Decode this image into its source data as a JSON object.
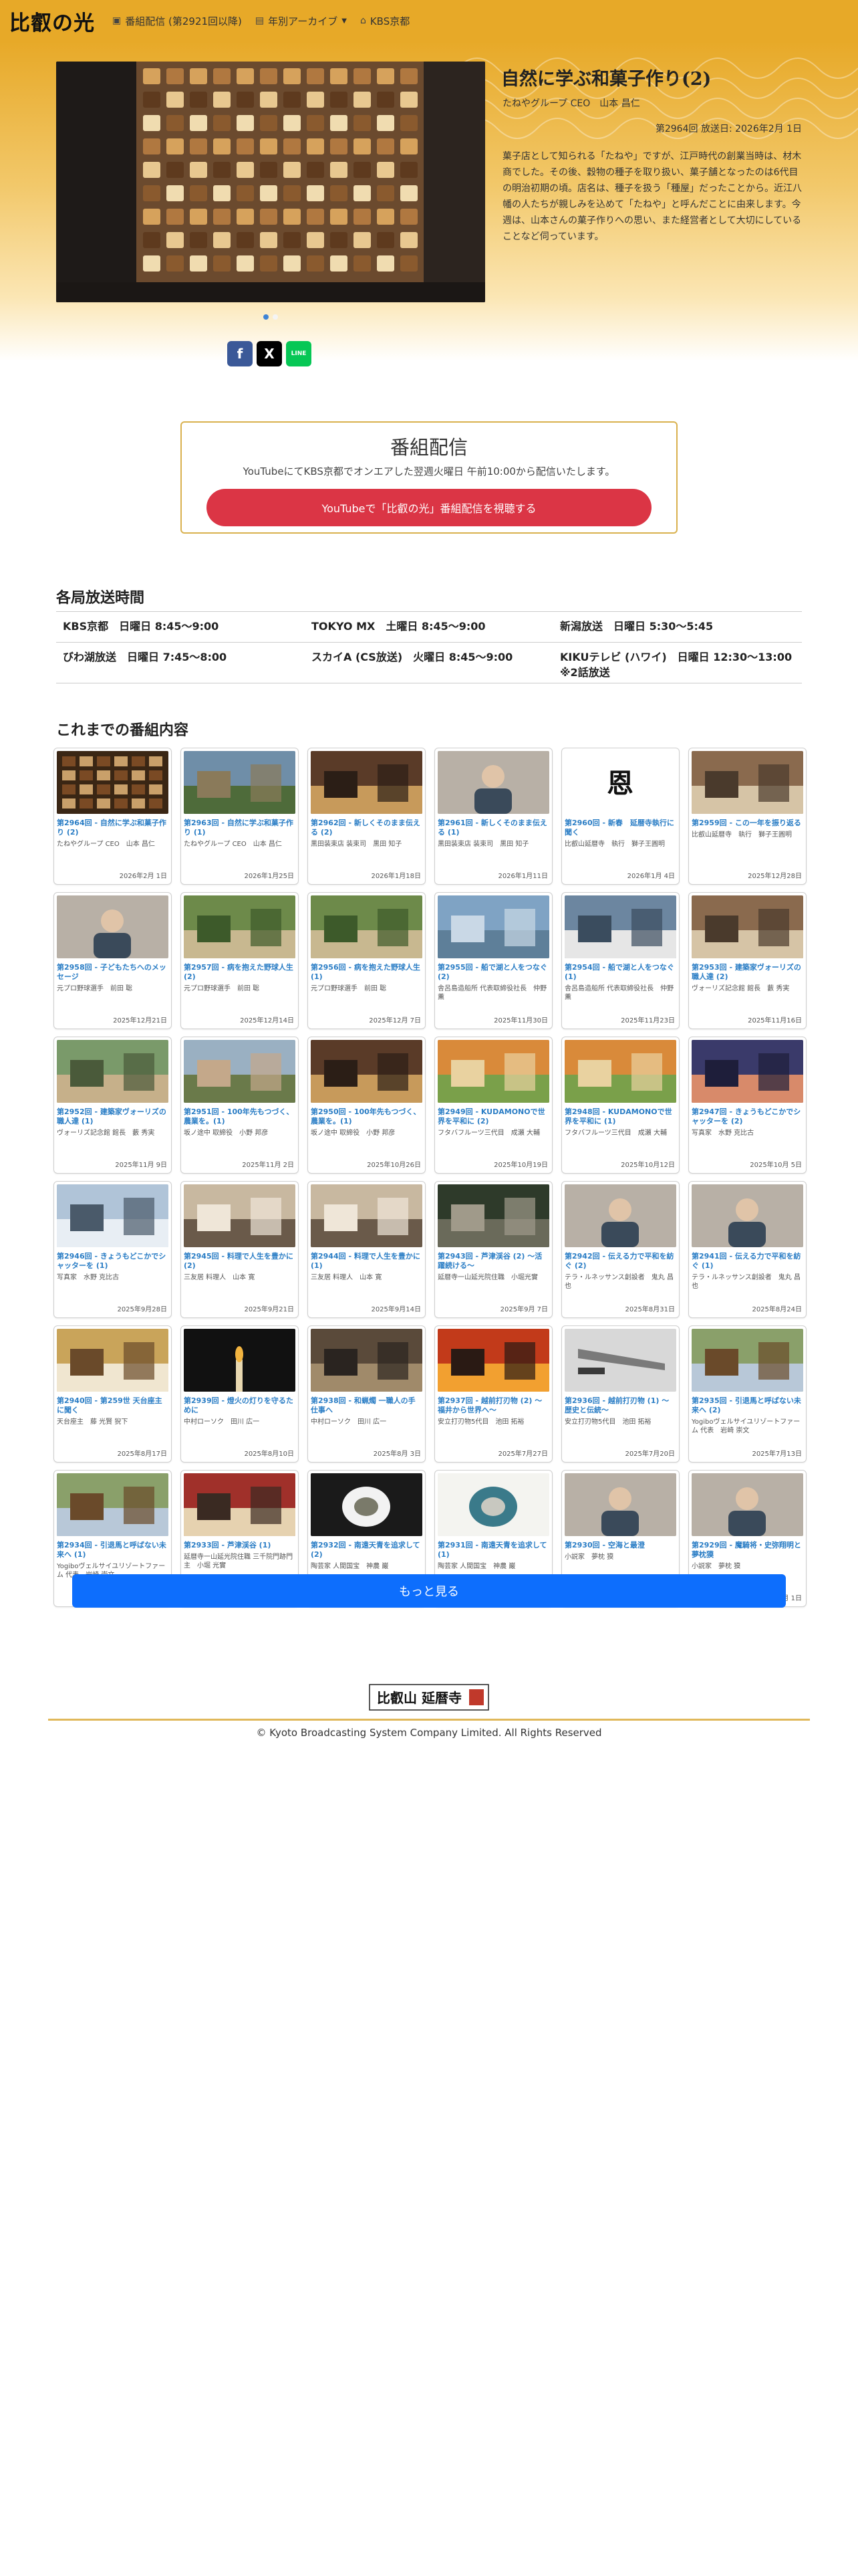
{
  "nav": {
    "brand": "比叡の光",
    "links": [
      {
        "label": "番組配信 (第2921回以降)",
        "icon": "tv-icon"
      },
      {
        "label": "年別アーカイブ",
        "icon": "calendar-icon"
      },
      {
        "label": "KBS京都",
        "icon": "home-icon"
      }
    ]
  },
  "featured": {
    "title": "自然に学ぶ和菓子作り(2)",
    "guest": "たねやグループ CEO　山本 昌仁",
    "date": "第2964回 放送日: 2026年2月 1日",
    "description": "菓子店として知られる「たねや」ですが、江戸時代の創業当時は、材木商でした。その後、穀物の種子を取り扱い、菓子舗となったのは6代目の明治初期の頃。店名は、種子を扱う「種屋」だったことから。近江八幡の人たちが親しみを込めて「たねや」と呼んだことに由来します。今週は、山本さんの菓子作りへの思い、また経営者として大切にしていることなど伺っています。"
  },
  "share": {
    "facebook": "f",
    "x": "X",
    "line": "LINE"
  },
  "broadcast": {
    "title": "番組配信",
    "text": "YouTubeにてKBS京都でオンエアした翌週火曜日 午前10:00から配信いたします。",
    "button": "YouTubeで「比叡の光」番組配信を視聴する"
  },
  "schedule": {
    "title": "各局放送時間",
    "rows": [
      [
        "KBS京都　日曜日 8:45〜9:00",
        "TOKYO MX　土曜日 8:45〜9:00",
        "新潟放送　日曜日 5:30〜5:45"
      ],
      [
        "びわ湖放送　日曜日 7:45〜8:00",
        "スカイA (CS放送)　火曜日 8:45〜9:00",
        "KIKUテレビ (ハワイ)　日曜日 12:30〜13:00\n※2話放送"
      ]
    ]
  },
  "episodes": {
    "title": "これまでの番組内容",
    "items": [
      {
        "title": "第2964回 - 自然に学ぶ和菓子作り (2)",
        "guest": "たねやグループ CEO　山本 昌仁",
        "date": "2026年2月 1日",
        "thumb": "sweets"
      },
      {
        "title": "第2963回 - 自然に学ぶ和菓子作り (1)",
        "guest": "たねやグループ CEO　山本 昌仁",
        "date": "2026年1月25日",
        "thumb": "landscape"
      },
      {
        "title": "第2962回 - 新しくそのまま伝える (2)",
        "guest": "黒田装束店 装束司　黒田 知子",
        "date": "2026年1月18日",
        "thumb": "interior"
      },
      {
        "title": "第2961回 - 新しくそのまま伝える (1)",
        "guest": "黒田装束店 装束司　黒田 知子",
        "date": "2026年1月11日",
        "thumb": "person"
      },
      {
        "title": "第2960回 - 新春　延暦寺執行に聞く",
        "guest": "比叡山延暦寺　執行　獅子王圓明",
        "date": "2026年1月 4日",
        "thumb": "calligraphy"
      },
      {
        "title": "第2959回 - この一年を振り返る",
        "guest": "比叡山延暦寺　執行　獅子王圓明",
        "date": "2025年12月28日",
        "thumb": "room"
      },
      {
        "title": "第2958回 - 子どもたちへのメッセージ",
        "guest": "元プロ野球選手　前田 聡",
        "date": "2025年12月21日",
        "thumb": "person"
      },
      {
        "title": "第2957回 - 病を抱えた野球人生 (2)",
        "guest": "元プロ野球選手　前田 聡",
        "date": "2025年12月14日",
        "thumb": "field"
      },
      {
        "title": "第2956回 - 病を抱えた野球人生 (1)",
        "guest": "元プロ野球選手　前田 聡",
        "date": "2025年12月 7日",
        "thumb": "field"
      },
      {
        "title": "第2955回 - 船で湖と人をつなぐ (2)",
        "guest": "舎呂島造船所 代表取締役社長　仲野 薫",
        "date": "2025年11月30日",
        "thumb": "lake"
      },
      {
        "title": "第2954回 - 船で湖と人をつなぐ (1)",
        "guest": "舎呂島造船所 代表取締役社長　仲野 薫",
        "date": "2025年11月23日",
        "thumb": "boat"
      },
      {
        "title": "第2953回 - 建築家ヴォーリズの職人達 (2)",
        "guest": "ヴォーリズ記念館 館長　藪 秀実",
        "date": "2025年11月16日",
        "thumb": "room"
      },
      {
        "title": "第2952回 - 建築家ヴォーリズの職人達 (1)",
        "guest": "ヴォーリズ記念館 館長　藪 秀実",
        "date": "2025年11月 9日",
        "thumb": "house"
      },
      {
        "title": "第2951回 - 100年先もつづく、農業を。(1)",
        "guest": "坂ノ途中 取締役　小野 邦彦",
        "date": "2025年11月 2日",
        "thumb": "crowd"
      },
      {
        "title": "第2950回 - 100年先もつづく、農業を。(1)",
        "guest": "坂ノ途中 取締役　小野 邦彦",
        "date": "2025年10月26日",
        "thumb": "interior"
      },
      {
        "title": "第2949回 - KUDAMONOで世界を平和に (2)",
        "guest": "フタバフルーツ三代目　成瀬 大輔",
        "date": "2025年10月19日",
        "thumb": "fruit"
      },
      {
        "title": "第2948回 - KUDAMONOで世界を平和に (1)",
        "guest": "フタバフルーツ三代目　成瀬 大輔",
        "date": "2025年10月12日",
        "thumb": "fruit"
      },
      {
        "title": "第2947回 - きょうもどこかでシャッターを (2)",
        "guest": "写真家　水野 克比古",
        "date": "2025年10月 5日",
        "thumb": "sunset"
      },
      {
        "title": "第2946回 - きょうもどこかでシャッターを (1)",
        "guest": "写真家　水野 克比古",
        "date": "2025年9月28日",
        "thumb": "bridge"
      },
      {
        "title": "第2945回 - 料理で人生を豊かに (2)",
        "guest": "三友居 料理人　山本 寛",
        "date": "2025年9月21日",
        "thumb": "kitchen"
      },
      {
        "title": "第2944回 - 料理で人生を豊かに (1)",
        "guest": "三友居 料理人　山本 寛",
        "date": "2025年9月14日",
        "thumb": "kitchen"
      },
      {
        "title": "第2943回 - 芦津渓谷 (2) 〜活躍続ける〜",
        "guest": "延暦寺一山延光院住職　小堀光實",
        "date": "2025年9月 7日",
        "thumb": "forest"
      },
      {
        "title": "第2942回 - 伝える力で平和を紡ぐ (2)",
        "guest": "テラ・ルネッサンス創設者　鬼丸 昌也",
        "date": "2025年8月31日",
        "thumb": "person"
      },
      {
        "title": "第2941回 - 伝える力で平和を紡ぐ (1)",
        "guest": "テラ・ルネッサンス創設者　鬼丸 昌也",
        "date": "2025年8月24日",
        "thumb": "person"
      },
      {
        "title": "第2940回 - 第259世 天台座主に聞く",
        "guest": "天台座主　藤 光賢 猊下",
        "date": "2025年8月17日",
        "thumb": "monk"
      },
      {
        "title": "第2939回 - 燈火の灯りを守るために",
        "guest": "中村ローソク　田川 広一",
        "date": "2025年8月10日",
        "thumb": "candle"
      },
      {
        "title": "第2938回 - 和蝋燭 一職人の手仕事へ",
        "guest": "中村ローソク　田川 広一",
        "date": "2025年8月 3日",
        "thumb": "workshop"
      },
      {
        "title": "第2937回 - 越前打刃物 (2) 〜福井から世界へ〜",
        "guest": "安立打刃物5代目　池田 拓裕",
        "date": "2025年7月27日",
        "thumb": "fire"
      },
      {
        "title": "第2936回 - 越前打刃物 (1) 〜歴史と伝統〜",
        "guest": "安立打刃物5代目　池田 拓裕",
        "date": "2025年7月20日",
        "thumb": "knife"
      },
      {
        "title": "第2935回 - 引退馬と呼ばない未来へ (2)",
        "guest": "Yogiboヴェルサイユリゾートファーム 代表　岩崎 崇文",
        "date": "2025年7月13日",
        "thumb": "horse"
      },
      {
        "title": "第2934回 - 引退馬と呼ばない未来へ (1)",
        "guest": "Yogiboヴェルサイユリゾートファーム 代表　岩崎 崇文",
        "date": "2025年7月 6日",
        "thumb": "horse"
      },
      {
        "title": "第2933回 - 芦津渓谷 (1)",
        "guest": "延暦寺一山延光院住職 三千院門跡門主　小堀 光實",
        "date": "2025年6月29日",
        "thumb": "shrine"
      },
      {
        "title": "第2932回 - 南遠天青を追求して (2)",
        "guest": "陶芸家 人間国宝　神農 巌",
        "date": "2025年6月22日",
        "thumb": "vase"
      },
      {
        "title": "第2931回 - 南遠天青を追求して (1)",
        "guest": "陶芸家 人間国宝　神農 巌",
        "date": "2025年6月15日",
        "thumb": "plate"
      },
      {
        "title": "第2930回 - 空海と最澄",
        "guest": "小説家　夢枕 獏",
        "date": "2025年6月 8日",
        "thumb": "person"
      },
      {
        "title": "第2929回 - 魔騎将・史弥翔明と夢枕獏",
        "guest": "小説家　夢枕 獏",
        "date": "2025年6月 1日",
        "thumb": "person"
      }
    ]
  },
  "more_button": "もっと見る",
  "footer": {
    "logo_text": "比叡山 延暦寺",
    "copyright": "© Kyoto Broadcasting System Company Limited. All Rights Reserved"
  },
  "colors": {
    "nav": "#e7a928",
    "accent": "#2a7dc5",
    "youtube": "#db3545",
    "more": "#0d6efd",
    "facebook": "#3b5998",
    "x": "#000000",
    "line": "#06c755"
  }
}
